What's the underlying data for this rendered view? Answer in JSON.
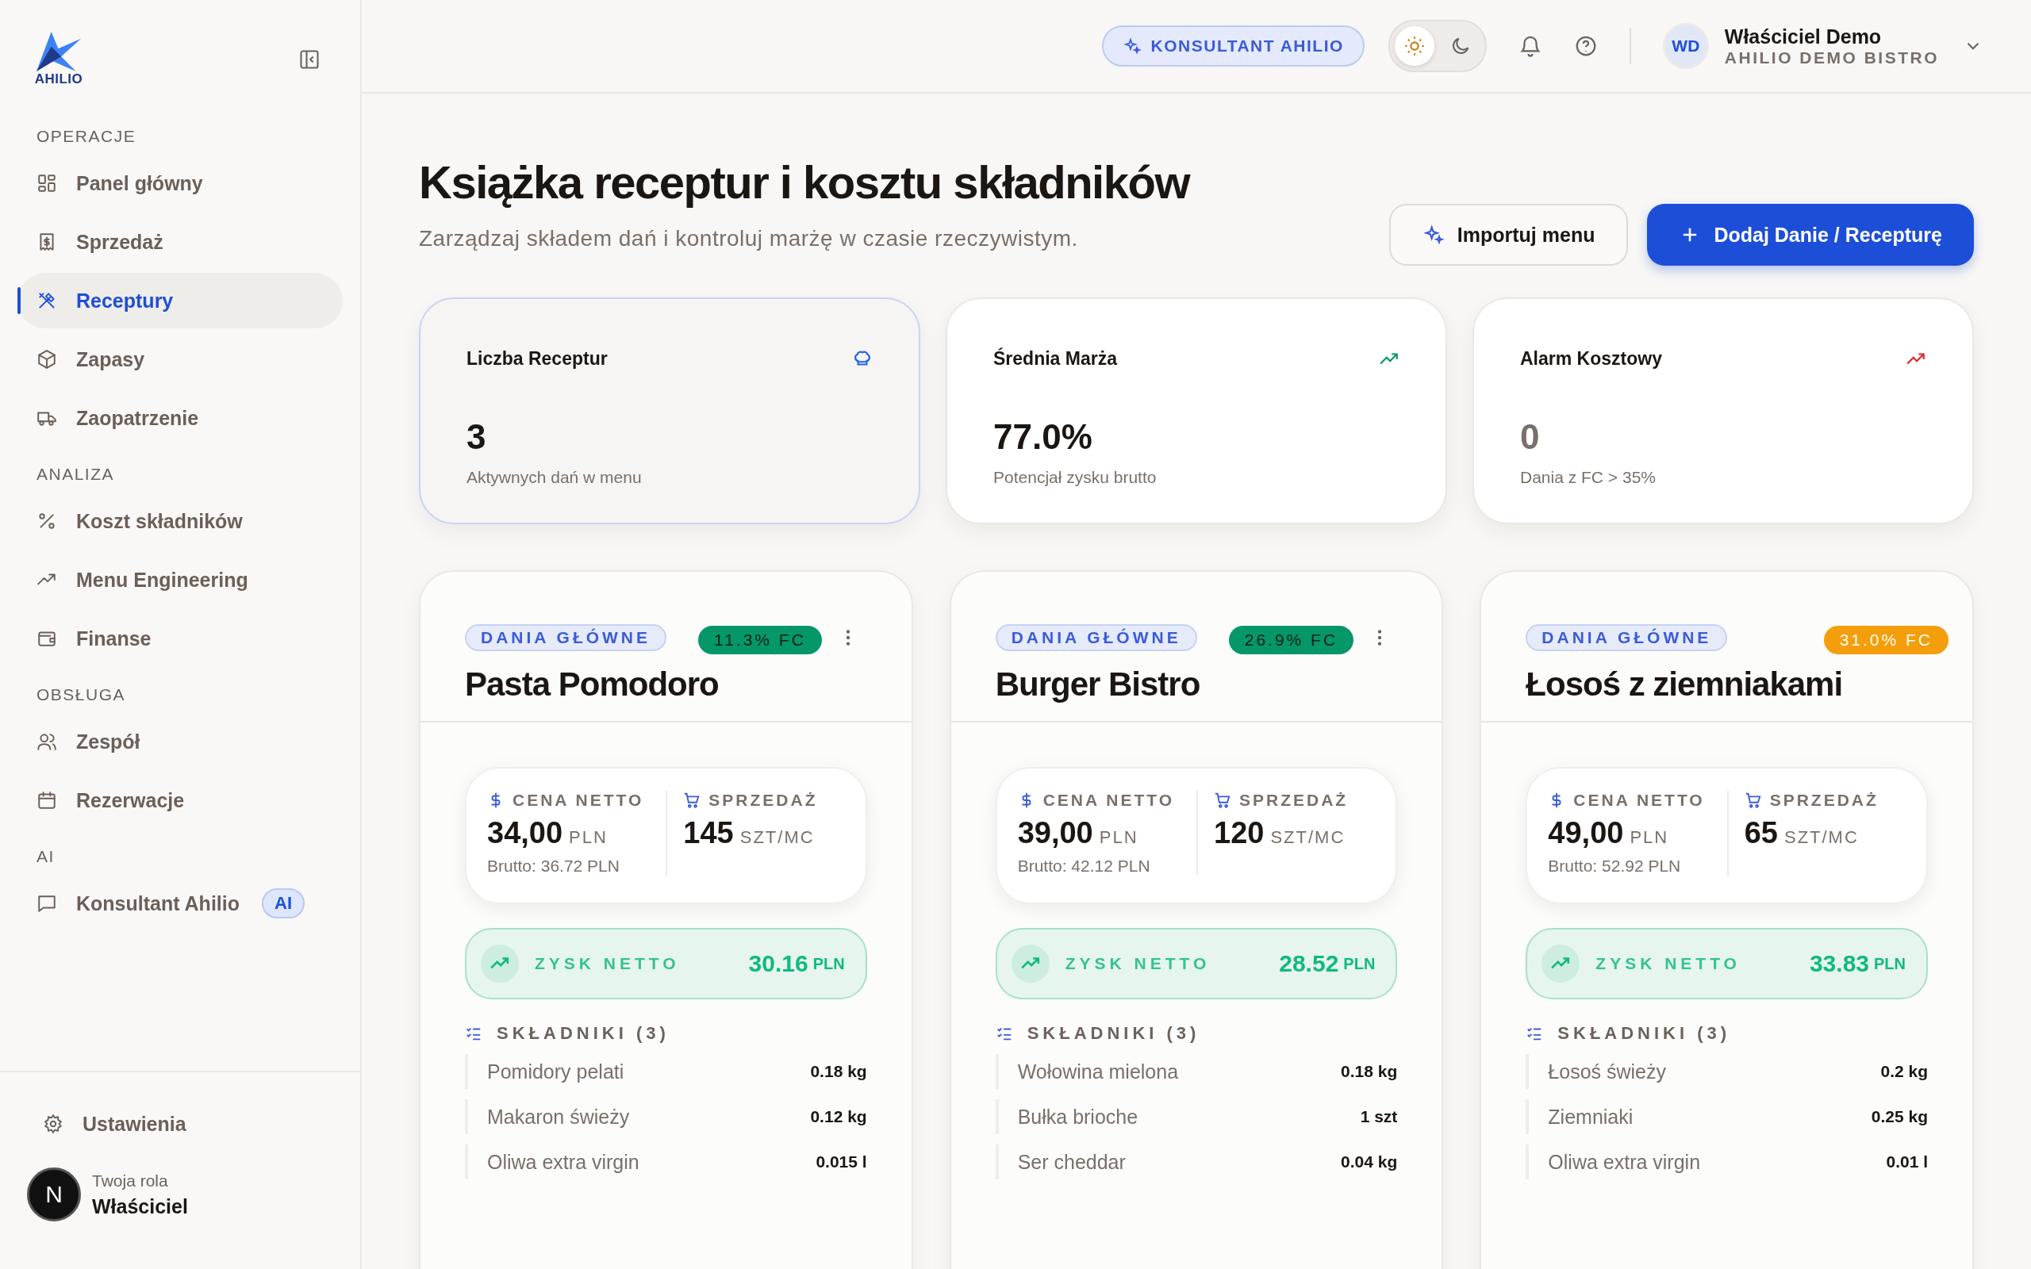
{
  "sidebar": {
    "logo": {
      "text": "AHILIO"
    },
    "sections": [
      {
        "title": "OPERACJE",
        "items": [
          {
            "kind": "grid",
            "label": "Panel główny",
            "selected": false
          },
          {
            "kind": "receipt",
            "label": "Sprzedaż",
            "selected": false
          },
          {
            "kind": "utensils",
            "label": "Receptury",
            "selected": true
          },
          {
            "kind": "box",
            "label": "Zapasy",
            "selected": false
          },
          {
            "kind": "truck",
            "label": "Zaopatrzenie",
            "selected": false
          }
        ]
      },
      {
        "title": "ANALIZA",
        "items": [
          {
            "kind": "percent",
            "label": "Koszt składników",
            "selected": false
          },
          {
            "kind": "trend",
            "label": "Menu Engineering",
            "selected": false
          },
          {
            "kind": "wallet",
            "label": "Finanse",
            "selected": false
          }
        ]
      },
      {
        "title": "OBSŁUGA",
        "items": [
          {
            "kind": "users",
            "label": "Zespół",
            "selected": false
          },
          {
            "kind": "calendar",
            "label": "Rezerwacje",
            "selected": false
          }
        ]
      },
      {
        "title": "AI",
        "items": [
          {
            "kind": "chat",
            "label": "Konsultant Ahilio",
            "selected": false,
            "badge": "AI"
          }
        ]
      }
    ],
    "settings": "Ustawienia",
    "role_label": "Twoja rola",
    "role": "Właściciel",
    "dev_badge": "N"
  },
  "header": {
    "assistant_button": "KONSULTANT AHILIO",
    "theme_options": [
      {
        "kind": "light",
        "selected": true
      },
      {
        "kind": "dark",
        "selected": false
      }
    ],
    "user": {
      "initials": "WD",
      "name": "Właściciel Demo",
      "company": "AHILIO DEMO BISTRO"
    }
  },
  "page": {
    "title": "Książka receptur i kosztu składników",
    "subtitle": "Zarządzaj składem dań i kontroluj marżę w czasie rzeczywistym.",
    "buttons": [
      {
        "kind": "secondary",
        "label": "Importuj menu"
      },
      {
        "kind": "primary",
        "label": "Dodaj Danie / Recepturę"
      }
    ]
  },
  "stats": [
    {
      "title": "Liczba Receptur",
      "kind": "chef-hat",
      "color": "#2563eb",
      "value": "3",
      "caption": "Aktywnych dań w menu",
      "selected": true,
      "muted": false
    },
    {
      "title": "Średnia Marża",
      "kind": "trend",
      "color": "#059669",
      "value": "77.0%",
      "caption": "Potencjał zysku brutto",
      "selected": false,
      "muted": false
    },
    {
      "title": "Alarm Kosztowy",
      "kind": "trend",
      "color": "#dc2626",
      "value": "0",
      "caption": "Dania z FC > 35%",
      "selected": false,
      "muted": true
    }
  ],
  "recipes": [
    {
      "category": "DANIA GŁÓWNE",
      "fc": "11.3% FC",
      "kind": "ok",
      "menu": true,
      "name": "Pasta Pomodoro",
      "price_label": "CENA NETTO",
      "price": "34,00",
      "currency": "PLN",
      "gross": "Brutto: 36.72 PLN",
      "sales_label": "SPRZEDAŻ",
      "sales": "145",
      "sales_unit": "SZT/MC",
      "profit_label": "ZYSK NETTO",
      "profit": "30.16",
      "profit_currency": "PLN",
      "ingredients_label": "SKŁADNIKI (3)",
      "ingredients": [
        {
          "name": "Pomidory pelati",
          "qty": "0.18 kg"
        },
        {
          "name": "Makaron świeży",
          "qty": "0.12 kg"
        },
        {
          "name": "Oliwa extra virgin",
          "qty": "0.015 l"
        }
      ]
    },
    {
      "category": "DANIA GŁÓWNE",
      "fc": "26.9% FC",
      "kind": "ok",
      "menu": true,
      "name": "Burger Bistro",
      "price_label": "CENA NETTO",
      "price": "39,00",
      "currency": "PLN",
      "gross": "Brutto: 42.12 PLN",
      "sales_label": "SPRZEDAŻ",
      "sales": "120",
      "sales_unit": "SZT/MC",
      "profit_label": "ZYSK NETTO",
      "profit": "28.52",
      "profit_currency": "PLN",
      "ingredients_label": "SKŁADNIKI (3)",
      "ingredients": [
        {
          "name": "Wołowina mielona",
          "qty": "0.18 kg"
        },
        {
          "name": "Bułka brioche",
          "qty": "1 szt"
        },
        {
          "name": "Ser cheddar",
          "qty": "0.04 kg"
        }
      ]
    },
    {
      "category": "DANIA GŁÓWNE",
      "fc": "31.0% FC",
      "kind": "warn",
      "menu": false,
      "name": "Łosoś z ziemniakami",
      "price_label": "CENA NETTO",
      "price": "49,00",
      "currency": "PLN",
      "gross": "Brutto: 52.92 PLN",
      "sales_label": "SPRZEDAŻ",
      "sales": "65",
      "sales_unit": "SZT/MC",
      "profit_label": "ZYSK NETTO",
      "profit": "33.83",
      "profit_currency": "PLN",
      "ingredients_label": "SKŁADNIKI (3)",
      "ingredients": [
        {
          "name": "Łosoś świeży",
          "qty": "0.2 kg"
        },
        {
          "name": "Ziemniaki",
          "qty": "0.25 kg"
        },
        {
          "name": "Oliwa extra virgin",
          "qty": "0.01 l"
        }
      ]
    }
  ]
}
